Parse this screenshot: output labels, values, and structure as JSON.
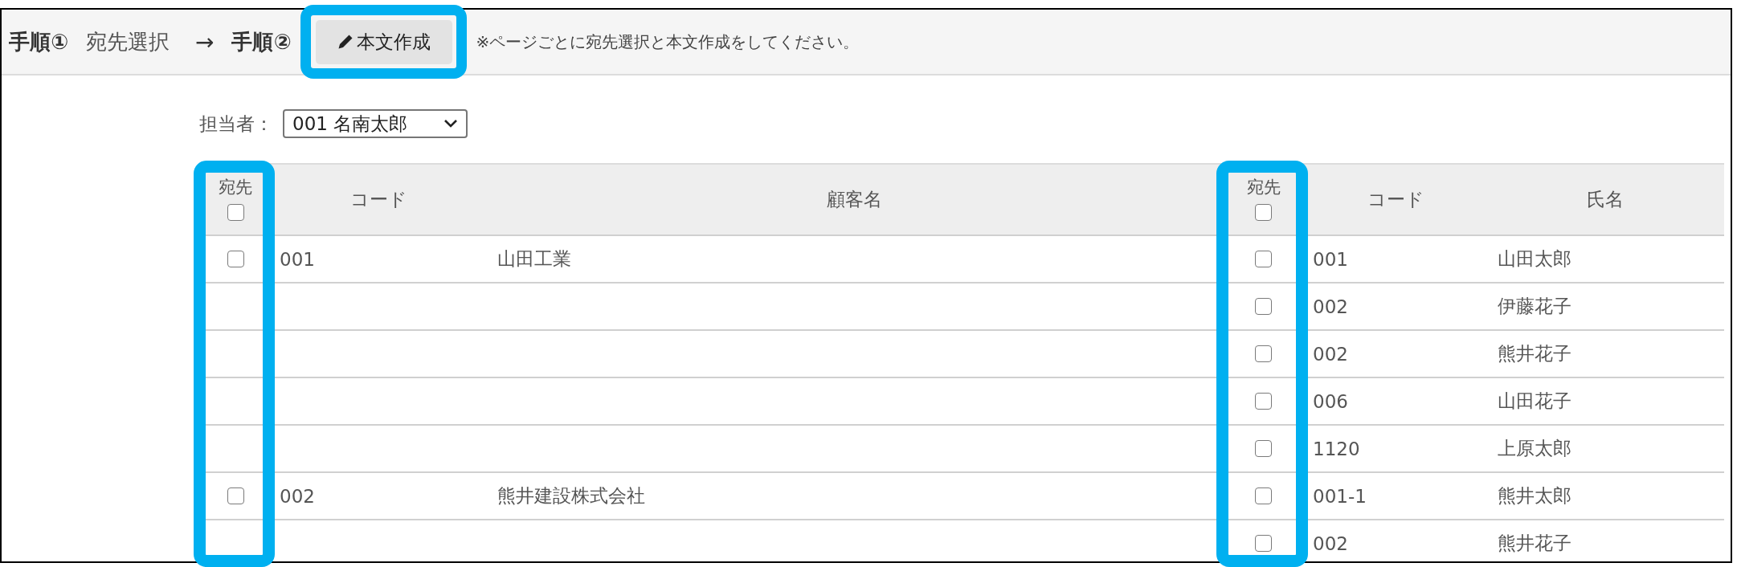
{
  "toolbar": {
    "items": [
      {
        "kind": "step",
        "text": "手順①"
      },
      {
        "kind": "label",
        "text": "宛先選択"
      },
      {
        "kind": "arrow",
        "text": "→"
      },
      {
        "kind": "step",
        "text": "手順②"
      },
      {
        "kind": "button",
        "text": "本文作成",
        "highlighted": true
      },
      {
        "kind": "note",
        "text": "※ページごとに宛先選択と本文作成をしてください。"
      }
    ]
  },
  "assignee": {
    "label": "担当者：",
    "value": "001 名南太郎"
  },
  "table": {
    "columns": [
      {
        "kind": "select",
        "label": "宛先",
        "checked": false,
        "highlighted": true
      },
      {
        "kind": "text",
        "label": "コード"
      },
      {
        "kind": "text",
        "label": "顧客名"
      },
      {
        "kind": "select",
        "label": "宛先",
        "checked": false,
        "highlighted": true
      },
      {
        "kind": "text",
        "label": "コード"
      },
      {
        "kind": "text",
        "label": "氏名"
      }
    ],
    "rows": [
      {
        "customer": {
          "checked": false,
          "code": "001",
          "name": "山田工業"
        },
        "contact": {
          "checked": false,
          "code": "001",
          "name": "山田太郎"
        }
      },
      {
        "contact": {
          "checked": false,
          "code": "002",
          "name": "伊藤花子"
        }
      },
      {
        "contact": {
          "checked": false,
          "code": "002",
          "name": "熊井花子"
        }
      },
      {
        "contact": {
          "checked": false,
          "code": "006",
          "name": "山田花子"
        }
      },
      {
        "contact": {
          "checked": false,
          "code": "1120",
          "name": "上原太郎"
        }
      },
      {
        "customer": {
          "checked": false,
          "code": "002",
          "name": "熊井建設株式会社"
        },
        "contact": {
          "checked": false,
          "code": "001-1",
          "name": "熊井太郎"
        }
      },
      {
        "contact": {
          "checked": false,
          "code": "002",
          "name": "熊井花子"
        }
      }
    ]
  }
}
